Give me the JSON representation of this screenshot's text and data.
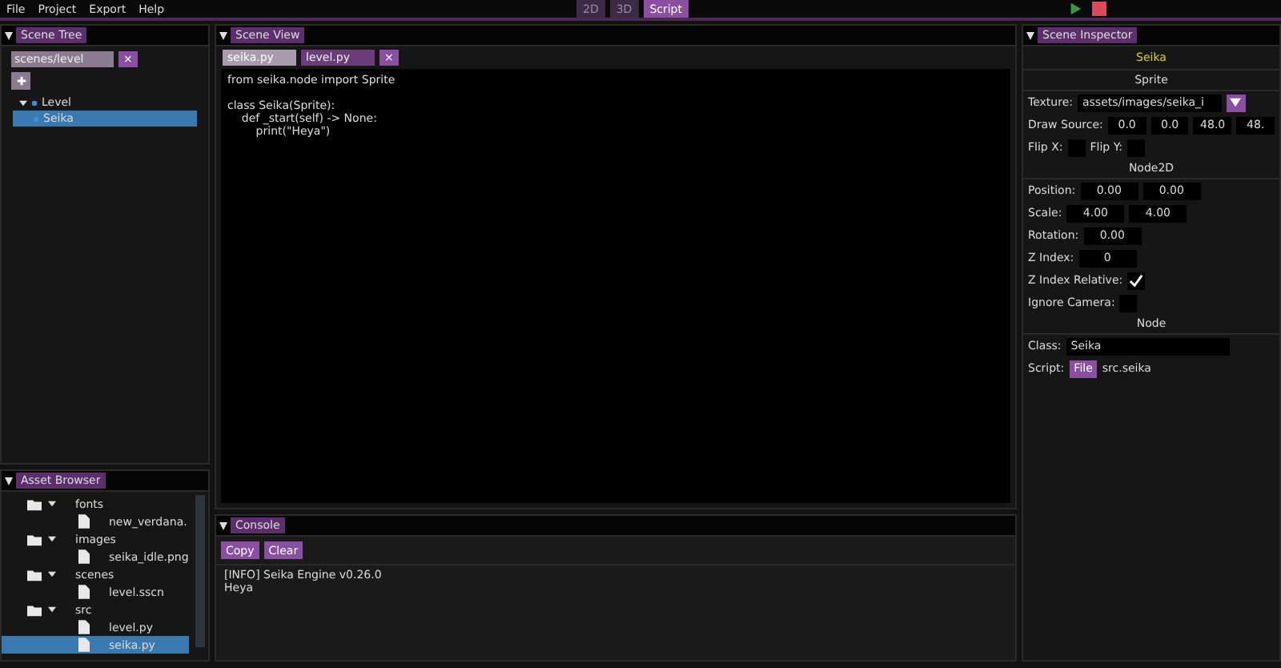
{
  "menu": [
    "File",
    "Project",
    "Export",
    "Help"
  ],
  "mode_tabs": [
    {
      "label": "2D",
      "selected": false
    },
    {
      "label": "3D",
      "selected": false
    },
    {
      "label": "Script",
      "selected": true
    }
  ],
  "scene_tree": {
    "title": "Scene Tree",
    "scene_path": "scenes/level",
    "close": "×",
    "nodes": [
      {
        "label": "Level",
        "expanded": true,
        "selected": false,
        "children": [
          {
            "label": "Seika",
            "selected": true
          }
        ]
      }
    ]
  },
  "asset_browser": {
    "title": "Asset Browser",
    "items": [
      {
        "kind": "folder",
        "label": "fonts",
        "expanded": true,
        "selected": false,
        "children": [
          {
            "kind": "file",
            "label": "new_verdana.",
            "selected": false
          }
        ]
      },
      {
        "kind": "folder",
        "label": "images",
        "expanded": true,
        "selected": false,
        "children": [
          {
            "kind": "file",
            "label": "seika_idle.png",
            "selected": false
          }
        ]
      },
      {
        "kind": "folder",
        "label": "scenes",
        "expanded": true,
        "selected": false,
        "children": [
          {
            "kind": "file",
            "label": "level.sscn",
            "selected": false
          }
        ]
      },
      {
        "kind": "folder",
        "label": "src",
        "expanded": true,
        "selected": false,
        "children": [
          {
            "kind": "file",
            "label": "level.py",
            "selected": false
          },
          {
            "kind": "file",
            "label": "seika.py",
            "selected": true
          }
        ]
      }
    ]
  },
  "scene_view": {
    "title": "Scene View",
    "tabs": [
      {
        "label": "seika.py",
        "selected": true
      },
      {
        "label": "level.py",
        "selected": false
      }
    ],
    "close": "×",
    "code_blocks": [
      [
        "from seika.node import Sprite"
      ],
      [
        "class Seika(Sprite):",
        "    def _start(self) -> None:",
        "        print(\"Heya\")"
      ]
    ]
  },
  "console": {
    "title": "Console",
    "buttons": [
      "Copy",
      "Clear"
    ],
    "lines": [
      "[INFO] Seika Engine v0.26.0",
      "Heya"
    ]
  },
  "inspector": {
    "title": "Scene Inspector",
    "node_name": "Seika",
    "sections": [
      {
        "title": "Sprite",
        "rows": [
          {
            "kind": "dropdown",
            "label": "Texture:",
            "value": "assets/images/seika_i"
          },
          {
            "kind": "fields",
            "label": "Draw Source:",
            "values": [
              "0.0",
              "0.0",
              "48.0",
              "48."
            ]
          },
          {
            "kind": "checks",
            "items": [
              {
                "label": "Flip X:",
                "checked": false
              },
              {
                "label": "Flip Y:",
                "checked": false
              }
            ]
          }
        ]
      },
      {
        "title": "Node2D",
        "rows": [
          {
            "kind": "fields",
            "label": "Position:",
            "values": [
              "0.00",
              "0.00"
            ]
          },
          {
            "kind": "fields",
            "label": "Scale:",
            "values": [
              "4.00",
              "4.00"
            ]
          },
          {
            "kind": "fields",
            "label": "Rotation:",
            "values": [
              "0.00"
            ]
          },
          {
            "kind": "fields",
            "label": "Z Index:",
            "values": [
              "0"
            ]
          },
          {
            "kind": "checks",
            "items": [
              {
                "label": "Z Index Relative:",
                "checked": true
              }
            ]
          },
          {
            "kind": "checks",
            "items": [
              {
                "label": "Ignore Camera:",
                "checked": false
              }
            ]
          }
        ]
      },
      {
        "title": "Node",
        "rows": [
          {
            "kind": "text",
            "label": "Class:",
            "value": "Seika"
          },
          {
            "kind": "file",
            "label": "Script:",
            "button": "File",
            "value": "src.seika"
          }
        ]
      }
    ]
  }
}
